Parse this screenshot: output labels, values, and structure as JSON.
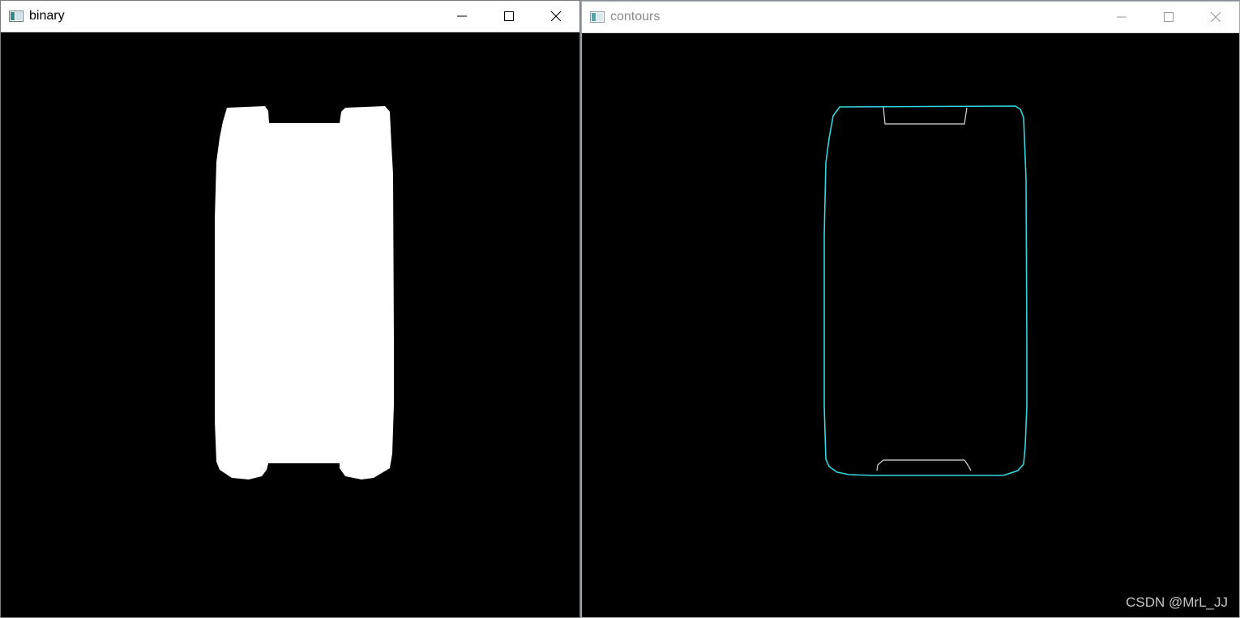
{
  "windows": {
    "binary": {
      "title": "binary",
      "icon": "opencv-window-icon"
    },
    "contours": {
      "title": "contours",
      "icon": "opencv-window-icon"
    }
  },
  "controls": {
    "icons": [
      "minimize-icon",
      "maximize-icon",
      "close-icon"
    ]
  },
  "colors": {
    "contour_outer": "#33d6e0",
    "contour_inner": "#d9d9d9",
    "binary_fill": "#ffffff",
    "canvas_bg": "#000000"
  },
  "watermark": {
    "text": "CSDN @MrL_JJ"
  }
}
